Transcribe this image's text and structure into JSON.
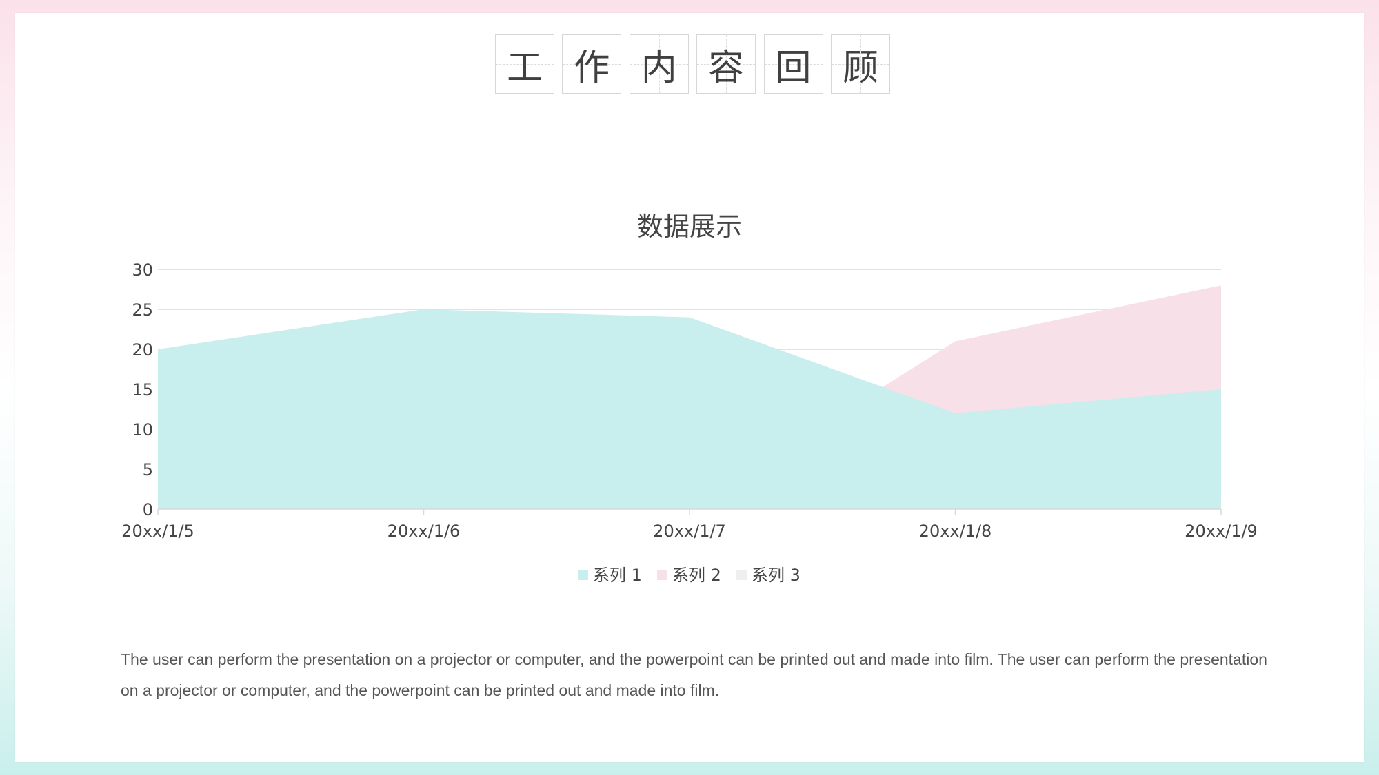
{
  "page": {
    "title_chars": [
      "工",
      "作",
      "内",
      "容",
      "回",
      "顾"
    ],
    "paragraph": "The user can perform the presentation on a projector or computer, and the powerpoint can be printed out and made into film. The user can perform the presentation on a projector or computer, and the powerpoint can be printed out and made into film."
  },
  "colors": {
    "series1": "#c8efed",
    "series2": "#f8e0e8",
    "series3": "#efefef",
    "text": "#444444",
    "grid": "#d9d9d9"
  },
  "chart_data": {
    "type": "area",
    "title": "数据展示",
    "categories": [
      "20xx/1/5",
      "20xx/1/6",
      "20xx/1/7",
      "20xx/1/8",
      "20xx/1/9"
    ],
    "series": [
      {
        "name": "系列 1",
        "values": [
          20,
          25,
          24,
          12,
          15
        ]
      },
      {
        "name": "系列 2",
        "values": [
          0,
          0,
          0,
          21,
          28
        ]
      },
      {
        "name": "系列 3",
        "values": [
          0,
          0,
          0,
          0,
          0
        ]
      }
    ],
    "ylim": [
      0,
      30
    ],
    "yticks": [
      0,
      5,
      10,
      15,
      20,
      25,
      30
    ],
    "grid": true,
    "legend": "bottom"
  }
}
